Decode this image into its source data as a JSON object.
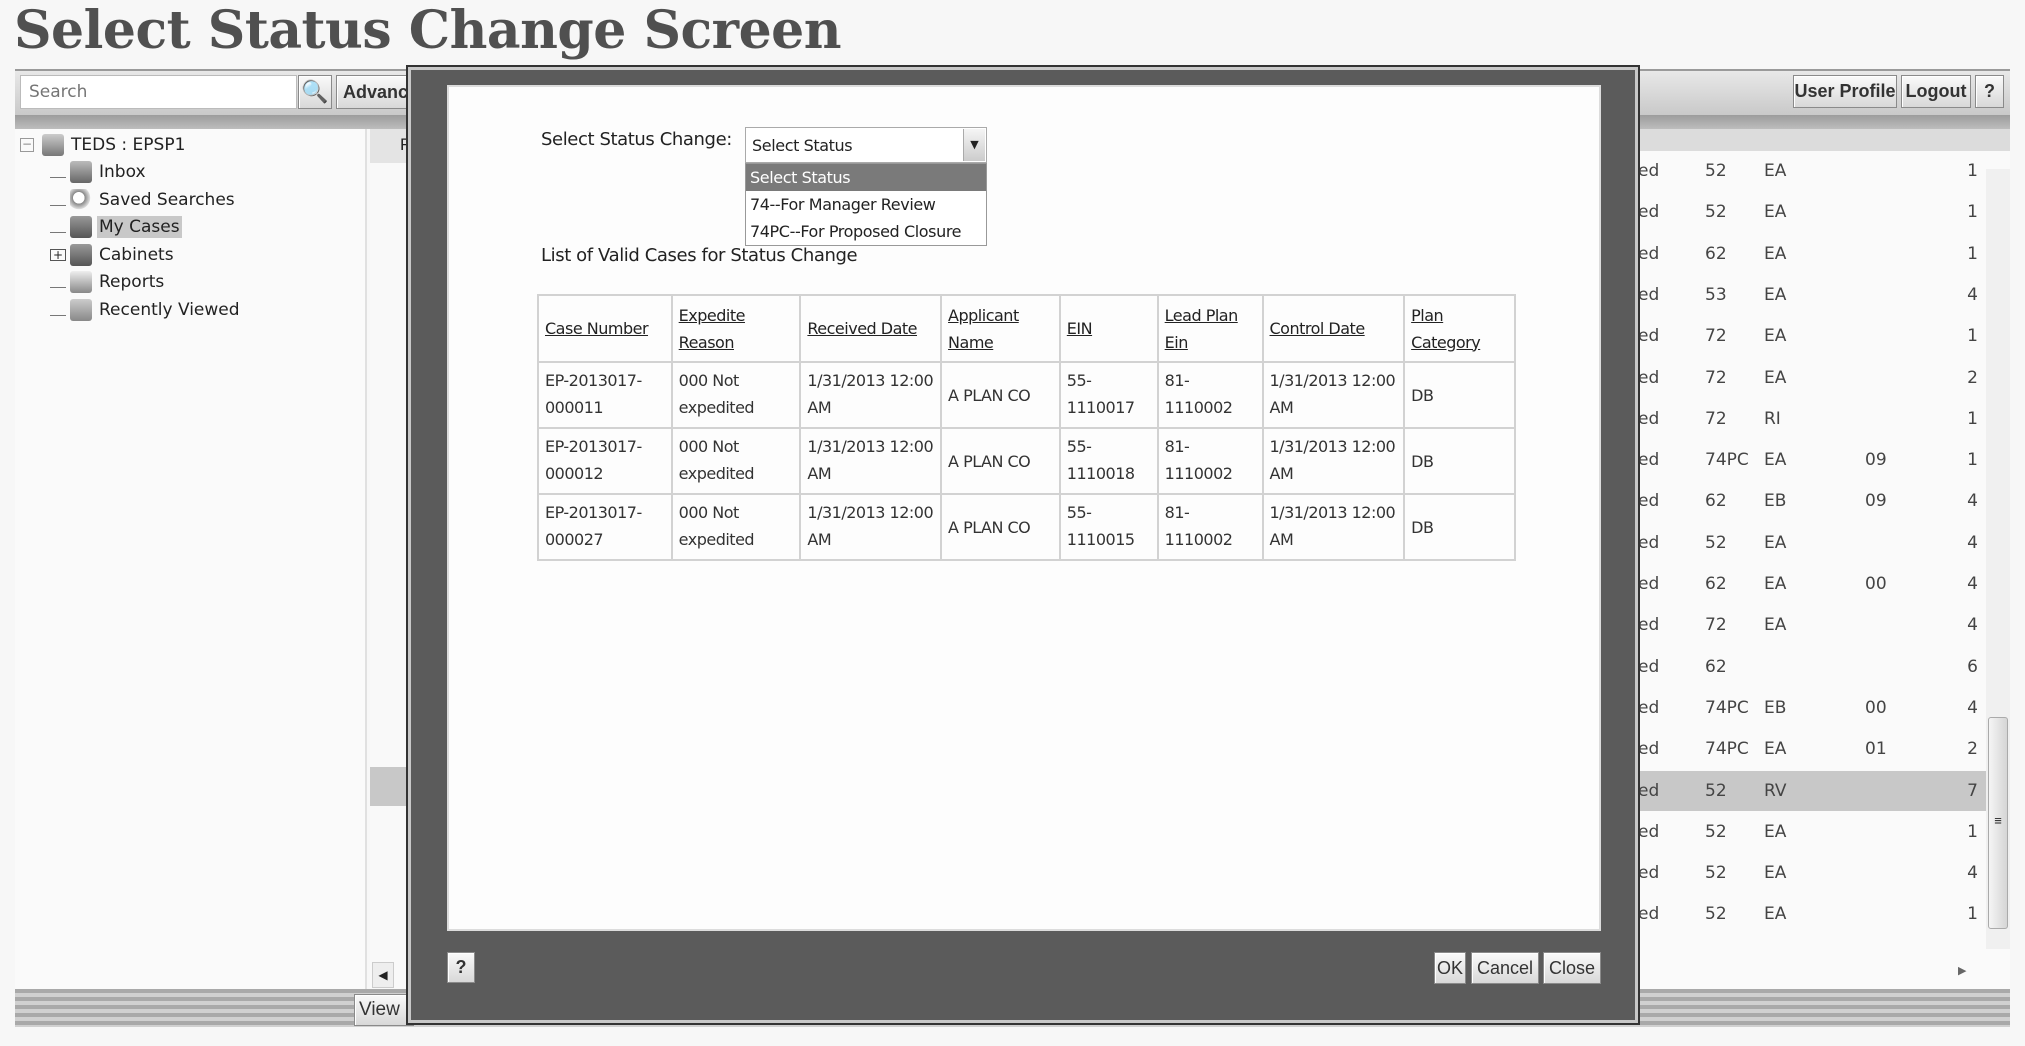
{
  "title": "Select Status Change Screen",
  "toolbar": {
    "search_placeholder": "Search",
    "advanced_label": "Advance",
    "user_profile": "User Profile",
    "logout": "Logout",
    "help": "?"
  },
  "tree": {
    "root": "TEDS : EPSP1",
    "items": [
      {
        "label": "Inbox",
        "icon": "inbox-icon"
      },
      {
        "label": "Saved Searches",
        "icon": "magnifier-icon"
      },
      {
        "label": "My Cases",
        "icon": "cases-icon",
        "selected": true
      },
      {
        "label": "Cabinets",
        "icon": "cabinet-icon",
        "expandable": true
      },
      {
        "label": "Reports",
        "icon": "report-icon"
      },
      {
        "label": "Recently Viewed",
        "icon": "star-icon"
      }
    ]
  },
  "middle": {
    "header_fragment": "F",
    "view_button": "View"
  },
  "list_rows": [
    [
      "ed",
      "52",
      "EA",
      "",
      "1"
    ],
    [
      "ed",
      "52",
      "EA",
      "",
      "1"
    ],
    [
      "ed",
      "62",
      "EA",
      "",
      "1"
    ],
    [
      "ed",
      "53",
      "EA",
      "",
      "4"
    ],
    [
      "ed",
      "72",
      "EA",
      "",
      "1"
    ],
    [
      "ed",
      "72",
      "EA",
      "",
      "2"
    ],
    [
      "ed",
      "72",
      "RI",
      "",
      "1"
    ],
    [
      "ed",
      "74PC",
      "EA",
      "09",
      "1"
    ],
    [
      "ed",
      "62",
      "EB",
      "09",
      "4"
    ],
    [
      "ed",
      "52",
      "EA",
      "",
      "4"
    ],
    [
      "ed",
      "62",
      "EA",
      "00",
      "4"
    ],
    [
      "ed",
      "72",
      "EA",
      "",
      "4"
    ],
    [
      "ed",
      "62",
      "",
      "",
      "6"
    ],
    [
      "ed",
      "74PC",
      "EB",
      "00",
      "4"
    ],
    [
      "ed",
      "74PC",
      "EA",
      "01",
      "2"
    ],
    [
      "ed",
      "52",
      "RV",
      "",
      "7"
    ],
    [
      "ed",
      "52",
      "EA",
      "",
      "1"
    ],
    [
      "ed",
      "52",
      "EA",
      "",
      "4"
    ],
    [
      "ed",
      "52",
      "EA",
      "",
      "1"
    ]
  ],
  "selected_list_row": 15,
  "dialog": {
    "status_label": "Select Status Change:",
    "select_value": "Select Status",
    "options": [
      "Select Status",
      "74--For Manager Review",
      "74PC--For Proposed Closure"
    ],
    "highlighted_option": 0,
    "list_title": "List of Valid Cases for Status Change",
    "columns": [
      "Case Number",
      "Expedite Reason",
      "Received Date",
      "Applicant Name",
      "EIN",
      "Lead Plan Ein",
      "Control Date",
      "Plan Category"
    ],
    "rows": [
      [
        "EP-2013017-000011",
        "000 Not expedited",
        "1/31/2013 12:00 AM",
        "A PLAN CO",
        "55-1110017",
        "81-1110002",
        "1/31/2013 12:00 AM",
        "DB"
      ],
      [
        "EP-2013017-000012",
        "000 Not expedited",
        "1/31/2013 12:00 AM",
        "A PLAN CO",
        "55-1110018",
        "81-1110002",
        "1/31/2013 12:00 AM",
        "DB"
      ],
      [
        "EP-2013017-000027",
        "000 Not expedited",
        "1/31/2013 12:00 AM",
        "A PLAN CO",
        "55-1110015",
        "81-1110002",
        "1/31/2013 12:00 AM",
        "DB"
      ]
    ],
    "help": "?",
    "ok": "OK",
    "cancel": "Cancel",
    "close": "Close"
  },
  "colors": {
    "dialog_frame": "#5b5b5b",
    "highlight_option": "#7a7a7a",
    "selected_row": "#c8c8c8"
  }
}
